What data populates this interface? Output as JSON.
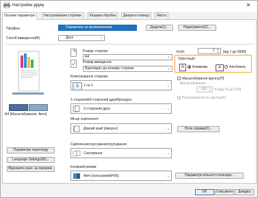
{
  "window": {
    "title": "Настройки друку",
    "close_glyph": "✕"
  },
  "tabs": [
    {
      "label": "Основні параметри",
      "active": true
    },
    {
      "label": "Настроювання сторінки"
    },
    {
      "label": "Кінцева обробка"
    },
    {
      "label": "Джерело паперу"
    },
    {
      "label": "Якість"
    }
  ],
  "profile": {
    "label": "Профіль:",
    "value": "Параметри за промовчанням",
    "add_button": "Додати(1)...",
    "edit_button": "Редагування(2)..."
  },
  "output_method": {
    "label": "Спосіб виведення(М):",
    "value": "Друк"
  },
  "preview": {
    "caption": "A4 [Масштабування: Авто]"
  },
  "left_buttons": {
    "view_settings": "Параметри перегляду",
    "language_settings": "Language Settings(W)...",
    "restore_defaults": "Відновити знач. за промовч."
  },
  "page_size": {
    "label": "Розмір сторінки:",
    "value": "A4",
    "output_size_label": "Розмір виведення:",
    "output_size_value": "Відповідно до розміру сторінки"
  },
  "copies": {
    "label": "Копії:",
    "value": "1",
    "range": "[від 1 до 9999]"
  },
  "orientation": {
    "label": "Орієнтація",
    "portrait_label": "Книжкова",
    "landscape_label": "Альбомна",
    "selected": "portrait"
  },
  "page_layout": {
    "label": "Компонування сторінки:",
    "value": "1 на 1",
    "icon_number": "1"
  },
  "manual_scaling": {
    "label": "Масштабування вручну(П)",
    "scaling_label": "Масштабування:",
    "value": "100",
    "range": "% [від 25 до 200]"
  },
  "center_placement": {
    "label": "Розташування по центру(Б)"
  },
  "duplex": {
    "label": "1-сторонній/2-сторонній друк/брошура:",
    "value": "2-сторонній друк"
  },
  "binding": {
    "label": "Місце скріплення:",
    "value": "Довгий край [ліворуч]",
    "margin_button": "Поле оправи(У)..."
  },
  "finishing": {
    "label": "Скріплення/сортування/групування:",
    "value": "Сортування"
  },
  "color_mode": {
    "label": "Колірний режим:",
    "value": "Авто [кольоровий/Ч/Б]",
    "color_settings_button": "Параметри кількості кольорів..."
  },
  "footer": {
    "ok": "OK",
    "cancel": "Скасувати",
    "help": "Довідка"
  },
  "colors": {
    "accent": "#f2a31e",
    "selection": "#1a73c7"
  }
}
